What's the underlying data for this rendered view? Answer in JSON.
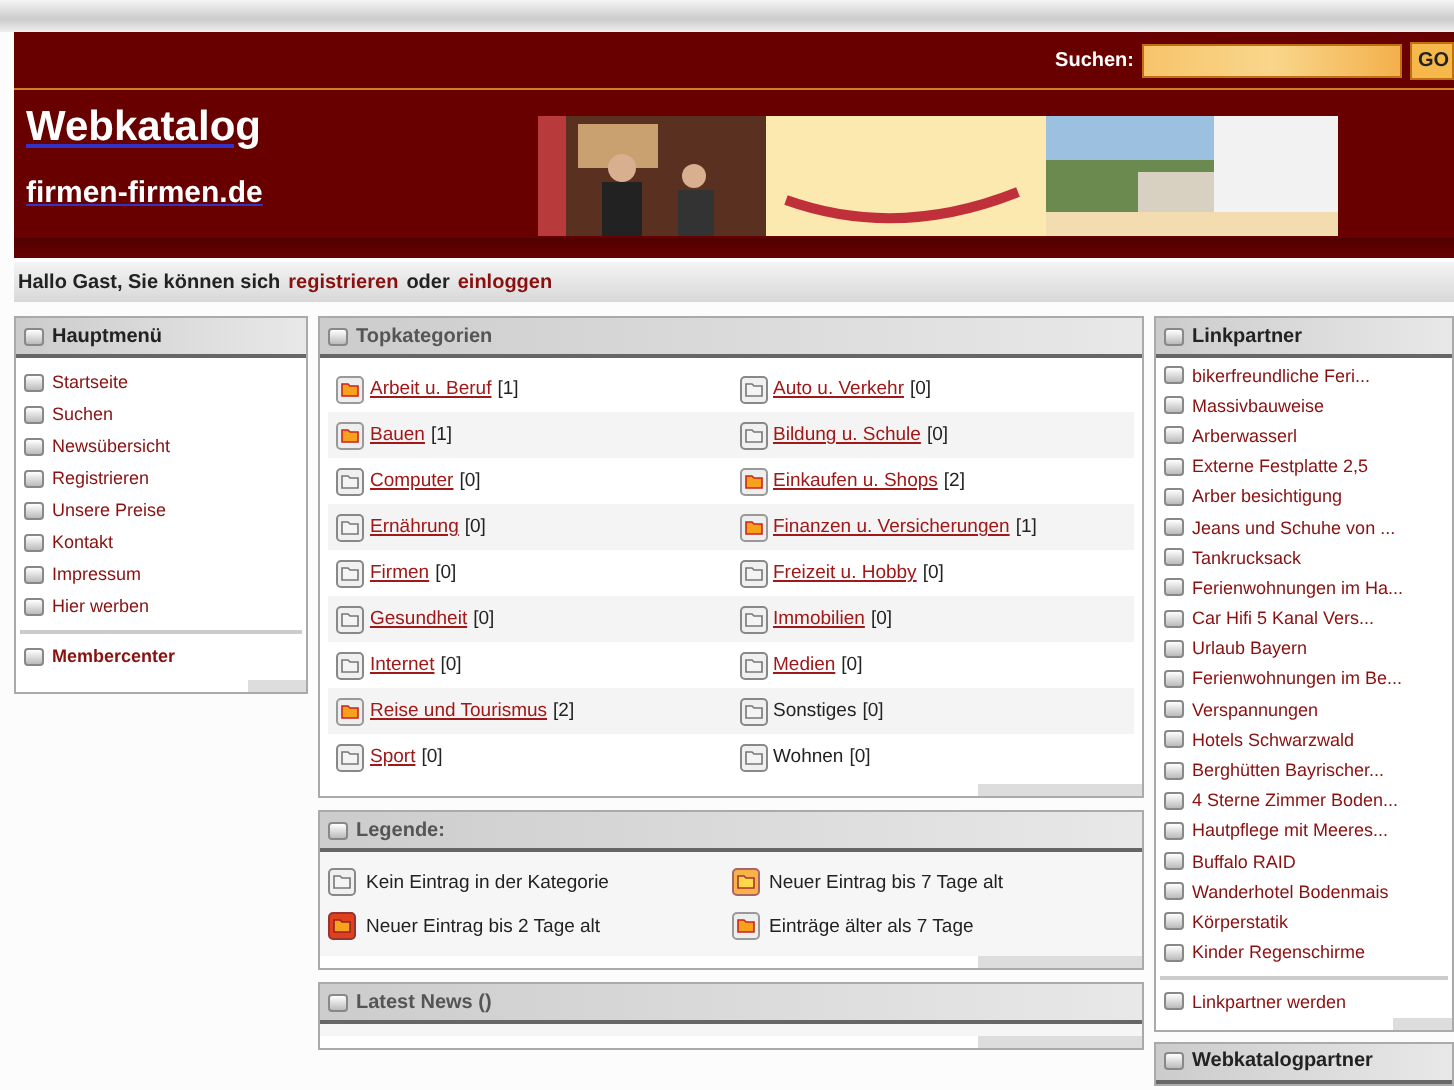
{
  "search": {
    "label": "Suchen:",
    "button": "GO"
  },
  "site": {
    "title": "Webkatalog",
    "domain": "firmen-firmen.de"
  },
  "greeting": {
    "text": "Hallo Gast, Sie können sich",
    "register": "registrieren",
    "or": "oder",
    "login": "einloggen"
  },
  "main_menu": {
    "title": "Hauptmenü",
    "items": [
      "Startseite",
      "Suchen",
      "Newsübersicht",
      "Registrieren",
      "Unsere Preise",
      "Kontakt",
      "Impressum",
      "Hier werben"
    ],
    "member": "Membercenter"
  },
  "top_categories": {
    "title": "Topkategorien",
    "items": [
      {
        "name": "Arbeit u. Beruf",
        "count": "[1]",
        "linked": true,
        "kind": "old"
      },
      {
        "name": "Auto u. Verkehr",
        "count": "[0]",
        "linked": true,
        "kind": "empty"
      },
      {
        "name": "Bauen",
        "count": "[1]",
        "linked": true,
        "kind": "old"
      },
      {
        "name": "Bildung u. Schule",
        "count": "[0]",
        "linked": true,
        "kind": "empty"
      },
      {
        "name": "Computer",
        "count": "[0]",
        "linked": true,
        "kind": "empty"
      },
      {
        "name": "Einkaufen u. Shops",
        "count": "[2]",
        "linked": true,
        "kind": "old"
      },
      {
        "name": "Ernährung",
        "count": "[0]",
        "linked": true,
        "kind": "empty"
      },
      {
        "name": "Finanzen u. Versicherungen",
        "count": "[1]",
        "linked": true,
        "kind": "old"
      },
      {
        "name": "Firmen",
        "count": "[0]",
        "linked": true,
        "kind": "empty"
      },
      {
        "name": "Freizeit u. Hobby",
        "count": "[0]",
        "linked": true,
        "kind": "empty"
      },
      {
        "name": "Gesundheit",
        "count": "[0]",
        "linked": true,
        "kind": "empty"
      },
      {
        "name": "Immobilien",
        "count": "[0]",
        "linked": true,
        "kind": "empty"
      },
      {
        "name": "Internet",
        "count": "[0]",
        "linked": true,
        "kind": "empty"
      },
      {
        "name": "Medien",
        "count": "[0]",
        "linked": true,
        "kind": "empty"
      },
      {
        "name": "Reise und Tourismus",
        "count": "[2]",
        "linked": true,
        "kind": "old"
      },
      {
        "name": "Sonstiges",
        "count": "[0]",
        "linked": false,
        "kind": "empty"
      },
      {
        "name": "Sport",
        "count": "[0]",
        "linked": true,
        "kind": "empty"
      },
      {
        "name": "Wohnen",
        "count": "[0]",
        "linked": false,
        "kind": "empty"
      }
    ]
  },
  "legend": {
    "title": "Legende:",
    "items": [
      {
        "text": "Kein Eintrag in der Kategorie",
        "kind": "empty"
      },
      {
        "text": "Neuer Eintrag bis 7 Tage alt",
        "kind": "new7"
      },
      {
        "text": "Neuer Eintrag bis 2 Tage alt",
        "kind": "new2"
      },
      {
        "text": "Einträge älter als 7 Tage",
        "kind": "old"
      }
    ]
  },
  "latest_news": {
    "title": "Latest News ()"
  },
  "link_partners": {
    "title": "Linkpartner",
    "items": [
      "bikerfreundliche Feri...",
      "Massivbauweise",
      "Arberwasserl",
      "Externe Festplatte 2,5",
      "Arber besichtigung",
      "Jeans und Schuhe von ...",
      "Tankrucksack",
      "Ferienwohnungen im Ha...",
      "Car Hifi 5 Kanal Vers...",
      "Urlaub Bayern",
      "Ferienwohnungen im Be...",
      "Verspannungen",
      "Hotels Schwarzwald",
      "Berghütten Bayrischer...",
      "4 Sterne Zimmer Boden...",
      "Hautpflege mit Meeres...",
      "Buffalo RAID",
      "Wanderhotel Bodenmais",
      "Körperstatik",
      "Kinder Regenschirme"
    ],
    "become": "Linkpartner werden"
  },
  "catalog_partners": {
    "title": "Webkatalogpartner"
  }
}
